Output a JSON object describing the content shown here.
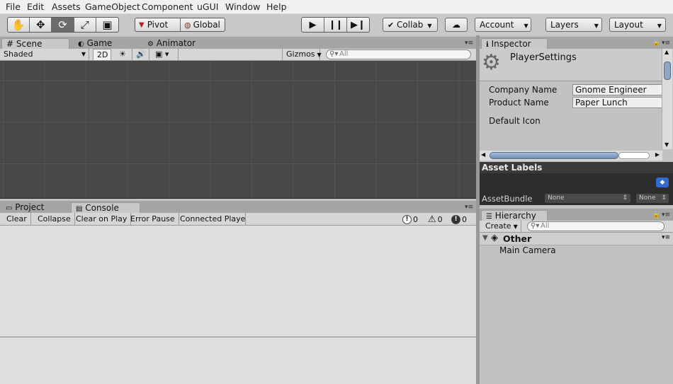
{
  "menu": [
    "File",
    "Edit",
    "Assets",
    "GameObject",
    "Component",
    "uGUI",
    "Window",
    "Help"
  ],
  "toolbar": {
    "tools": [
      "hand-tool-icon",
      "move-tool-icon",
      "rotate-tool-icon",
      "scale-tool-icon",
      "rect-tool-icon"
    ],
    "pivot_label": "Pivot",
    "global_label": "Global",
    "collab_label": "Collab",
    "account_label": "Account",
    "layers_label": "Layers",
    "layout_label": "Layout"
  },
  "scene_tabs": [
    "Scene",
    "Game",
    "Animator"
  ],
  "scene_toolbar": {
    "shading": "Shaded",
    "mode_2d": "2D",
    "gizmos": "Gizmos",
    "search_placeholder": "All"
  },
  "bottom_tabs": [
    "Project",
    "Console"
  ],
  "console_toolbar": {
    "clear": "Clear",
    "collapse": "Collapse",
    "clear_on_play": "Clear on Play",
    "error_pause": "Error Pause",
    "connected_player": "Connected Player",
    "log_count": "0",
    "warning_count": "0",
    "error_count": "0"
  },
  "inspector": {
    "tab": "Inspector",
    "title": "PlayerSettings",
    "fields": [
      {
        "label": "Company Name",
        "value": "Gnome Engineer"
      },
      {
        "label": "Product Name",
        "value": "Paper Lunch"
      }
    ],
    "default_icon_label": "Default Icon",
    "asset_labels_title": "Asset Labels",
    "assetbundle_label": "AssetBundle",
    "assetbundle_value": "None",
    "assetbundle_variant": "None"
  },
  "hierarchy": {
    "tab": "Hierarchy",
    "create_label": "Create",
    "search_placeholder": "All",
    "scene_name": "Other",
    "items": [
      "Main Camera"
    ]
  },
  "colors": {
    "scene_bg": "#484848",
    "panel_bg": "#c2c2c2",
    "asset_labels_bg": "#2d2d2d",
    "tag_icon_blue": "#2f6bd0"
  }
}
